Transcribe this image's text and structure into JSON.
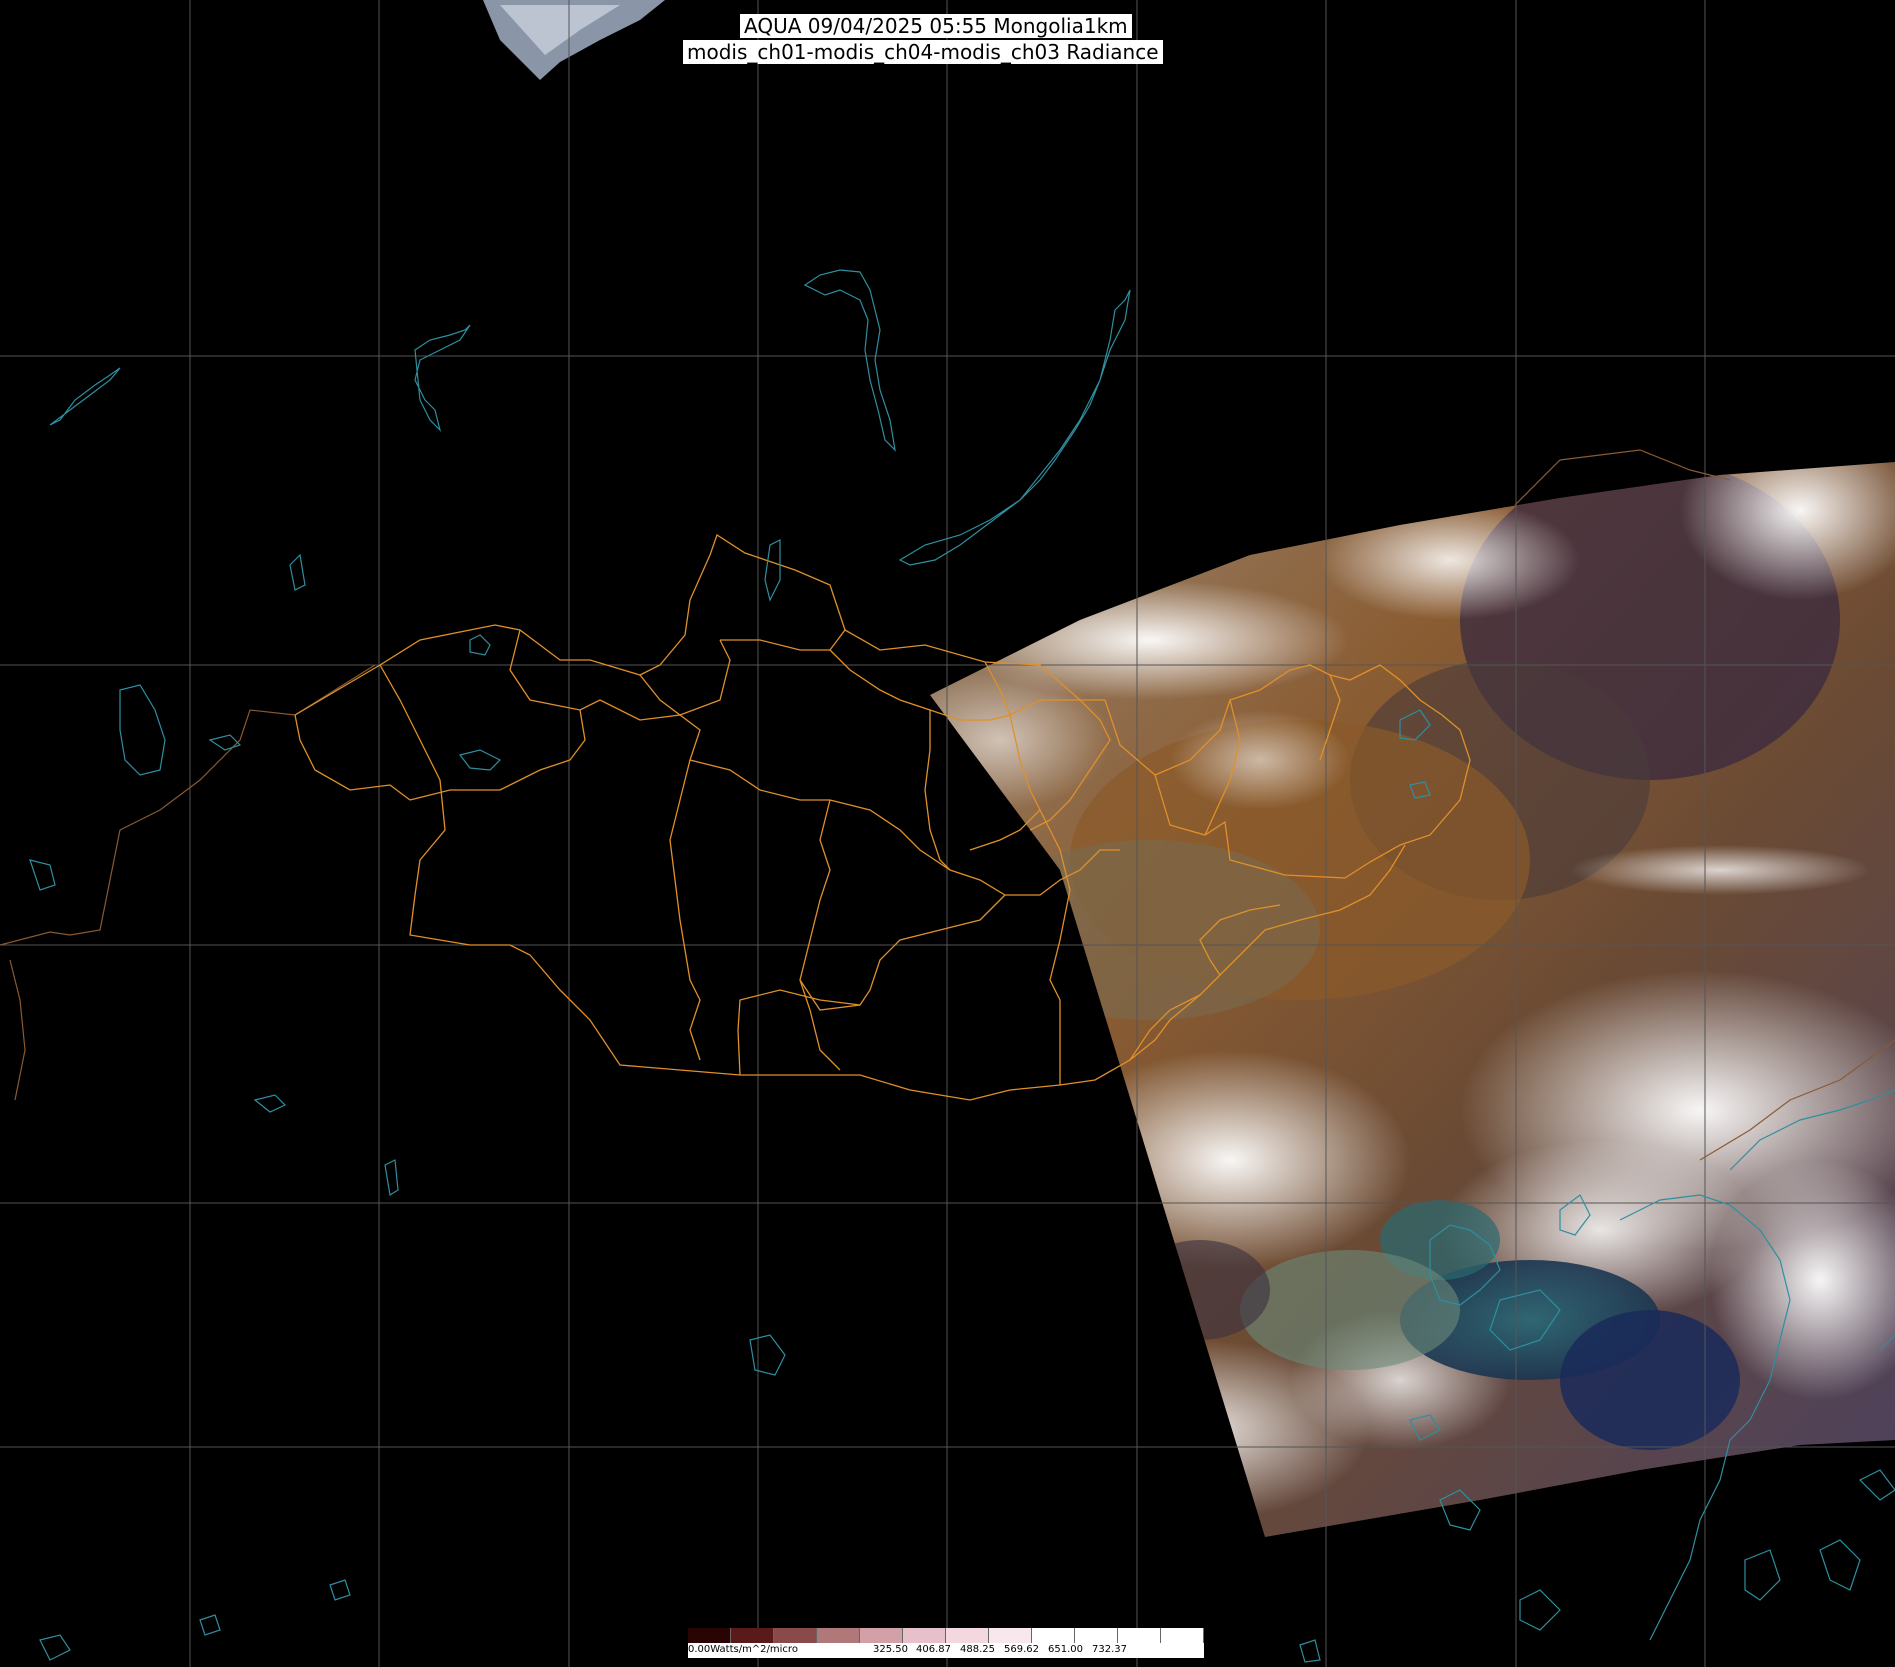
{
  "title": {
    "line1": "AQUA 09/04/2025 05:55 Mongolia1km",
    "line2": "modis_ch01-modis_ch04-modis_ch03 Radiance"
  },
  "colorbar": {
    "unit_label": "0.00Watts/m^2/micro",
    "ticks": [
      "325.50",
      "406.87",
      "488.25",
      "569.62",
      "651.00",
      "732.37"
    ],
    "colors": [
      "#2a0404",
      "#5a1a1a",
      "#8a4a4a",
      "#b07878",
      "#d4a0a8",
      "#e8c0cc",
      "#f3d8e0",
      "#f8e8ee",
      "#ffffff",
      "#ffffff",
      "#ffffff",
      "#ffffff"
    ]
  },
  "colors": {
    "background": "#000000",
    "graticule": "#555555",
    "borders": "#e0902a",
    "coastlines": "#2e8fa0",
    "country_outline": "#8a5a32"
  }
}
